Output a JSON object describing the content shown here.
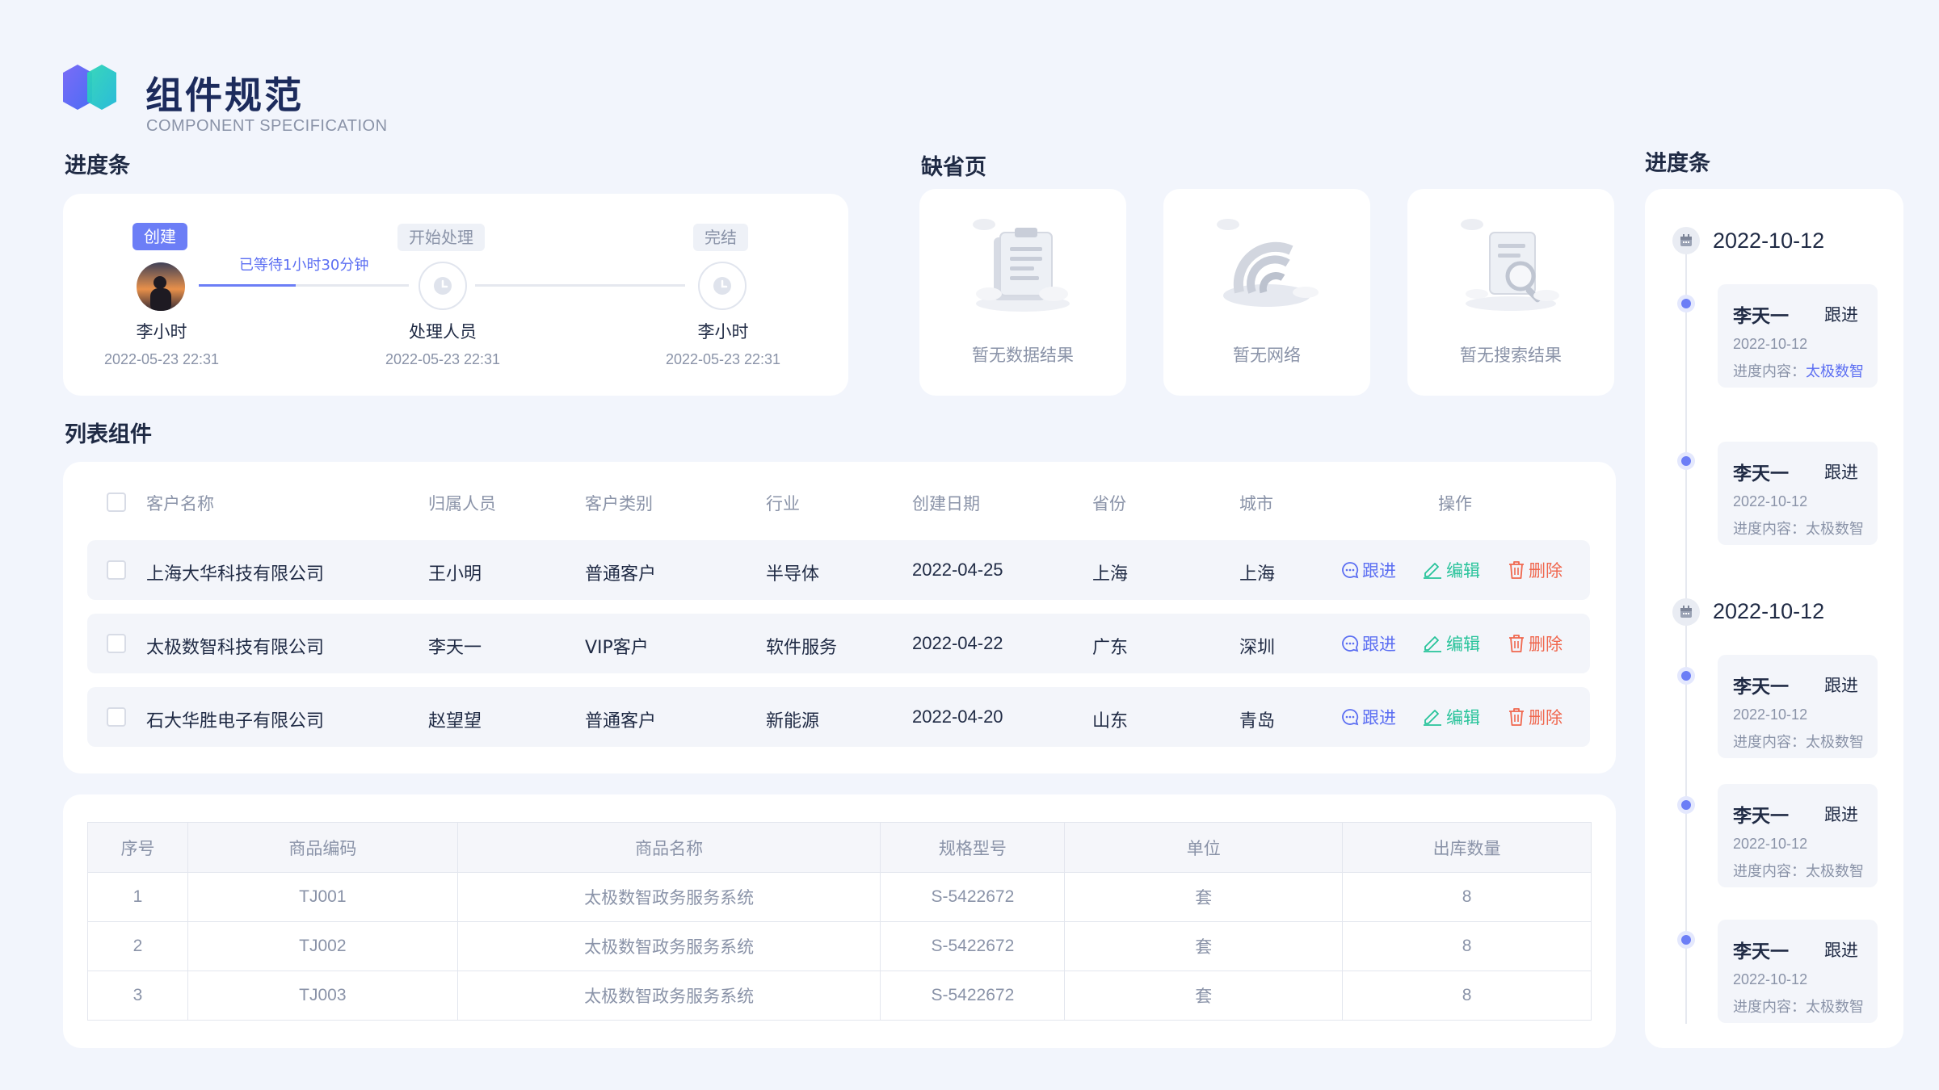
{
  "header": {
    "title": "组件规范",
    "subtitle": "COMPONENT SPECIFICATION"
  },
  "sections": {
    "progress": "进度条",
    "empty": "缺省页",
    "list": "列表组件",
    "timeline": "进度条"
  },
  "steps": {
    "wait_text": "已等待1小时30分钟",
    "items": [
      {
        "tag": "创建",
        "name": "李小时",
        "time": "2022-05-23 22:31"
      },
      {
        "tag": "开始处理",
        "name": "处理人员",
        "time": "2022-05-23 22:31"
      },
      {
        "tag": "完结",
        "name": "李小时",
        "time": "2022-05-23 22:31"
      }
    ]
  },
  "empty_states": [
    {
      "label": "暂无数据结果",
      "icon": "clipboard-icon"
    },
    {
      "label": "暂无网络",
      "icon": "wifi-icon"
    },
    {
      "label": "暂无搜索结果",
      "icon": "search-document-icon"
    }
  ],
  "list": {
    "headers": [
      "客户名称",
      "归属人员",
      "客户类别",
      "行业",
      "创建日期",
      "省份",
      "城市",
      "操作"
    ],
    "actions": {
      "follow": "跟进",
      "edit": "编辑",
      "delete": "删除"
    },
    "rows": [
      [
        "上海大华科技有限公司",
        "王小明",
        "普通客户",
        "半导体",
        "2022-04-25",
        "上海",
        "上海"
      ],
      [
        "太极数智科技有限公司",
        "李天一",
        "VIP客户",
        "软件服务",
        "2022-04-22",
        "广东",
        "深圳"
      ],
      [
        "石大华胜电子有限公司",
        "赵望望",
        "普通客户",
        "新能源",
        "2022-04-20",
        "山东",
        "青岛"
      ]
    ],
    "colors": {
      "follow": "#5b6ef2",
      "edit": "#27c39a",
      "delete": "#f0674e"
    }
  },
  "goods": {
    "headers": [
      "序号",
      "商品编码",
      "商品名称",
      "规格型号",
      "单位",
      "出库数量"
    ],
    "rows": [
      [
        "1",
        "TJ001",
        "太极数智政务服务系统",
        "S-5422672",
        "套",
        "8"
      ],
      [
        "2",
        "TJ002",
        "太极数智政务服务系统",
        "S-5422672",
        "套",
        "8"
      ],
      [
        "3",
        "TJ003",
        "太极数智政务服务系统",
        "S-5422672",
        "套",
        "8"
      ]
    ]
  },
  "timeline": {
    "content_label": "进度内容：",
    "groups": [
      {
        "date": "2022-10-12",
        "items": [
          {
            "name": "李天一",
            "action": "跟进",
            "time": "2022-10-12",
            "content": "太极数智"
          },
          {
            "name": "李天一",
            "action": "跟进",
            "time": "2022-10-12",
            "content": "太极数智"
          }
        ]
      },
      {
        "date": "2022-10-12",
        "items": [
          {
            "name": "李天一",
            "action": "跟进",
            "time": "2022-10-12",
            "content": "太极数智"
          },
          {
            "name": "李天一",
            "action": "跟进",
            "time": "2022-10-12",
            "content": "太极数智"
          },
          {
            "name": "李天一",
            "action": "跟进",
            "time": "2022-10-12",
            "content": "太极数智"
          }
        ]
      }
    ]
  },
  "theme": {
    "accent": "#6c7ef6",
    "title": "#1c2b5c",
    "muted": "#8a93a8"
  }
}
